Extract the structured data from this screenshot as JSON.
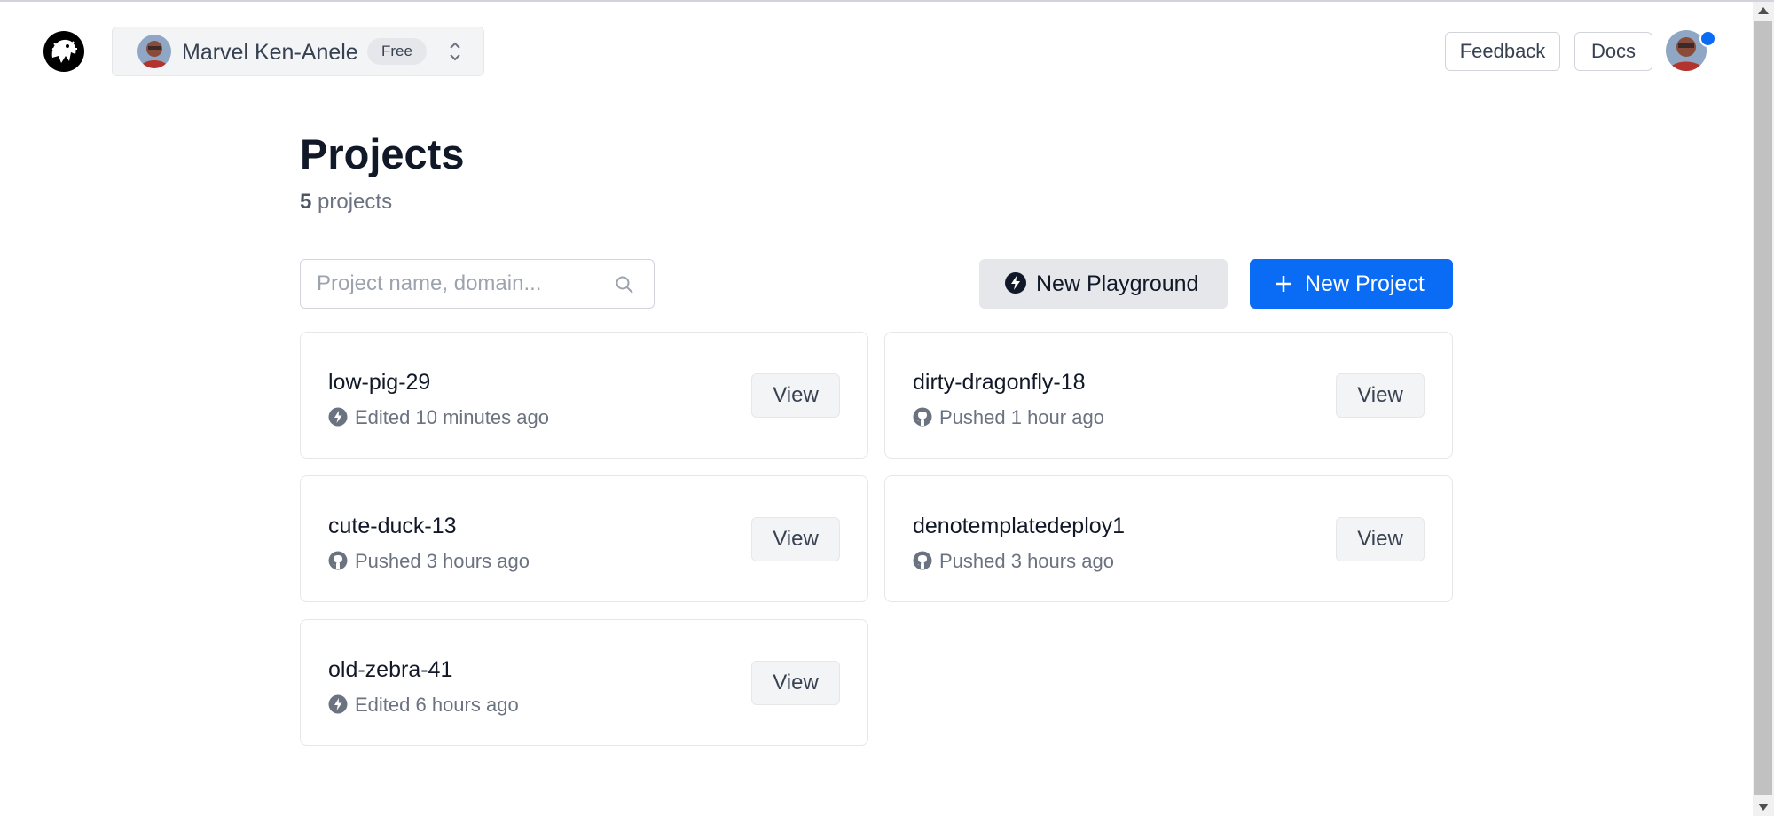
{
  "header": {
    "org_name": "Marvel Ken-Anele",
    "plan": "Free",
    "feedback_label": "Feedback",
    "docs_label": "Docs"
  },
  "main": {
    "title": "Projects",
    "count": "5",
    "count_suffix": "projects",
    "search_placeholder": "Project name, domain...",
    "new_playground_label": "New Playground",
    "new_project_label": "New Project"
  },
  "projects": [
    {
      "name": "low-pig-29",
      "status": "Edited 10 minutes ago",
      "icon": "playground-bolt-icon",
      "view_label": "View"
    },
    {
      "name": "dirty-dragonfly-18",
      "status": "Pushed 1 hour ago",
      "icon": "github-icon",
      "view_label": "View"
    },
    {
      "name": "cute-duck-13",
      "status": "Pushed 3 hours ago",
      "icon": "github-icon",
      "view_label": "View"
    },
    {
      "name": "denotemplatedeploy1",
      "status": "Pushed 3 hours ago",
      "icon": "github-icon",
      "view_label": "View"
    },
    {
      "name": "old-zebra-41",
      "status": "Edited 6 hours ago",
      "icon": "playground-bolt-icon",
      "view_label": "View"
    }
  ],
  "colors": {
    "accent": "#0a6cf5",
    "muted_text": "#6b7280",
    "card_border": "#e5e7eb"
  }
}
